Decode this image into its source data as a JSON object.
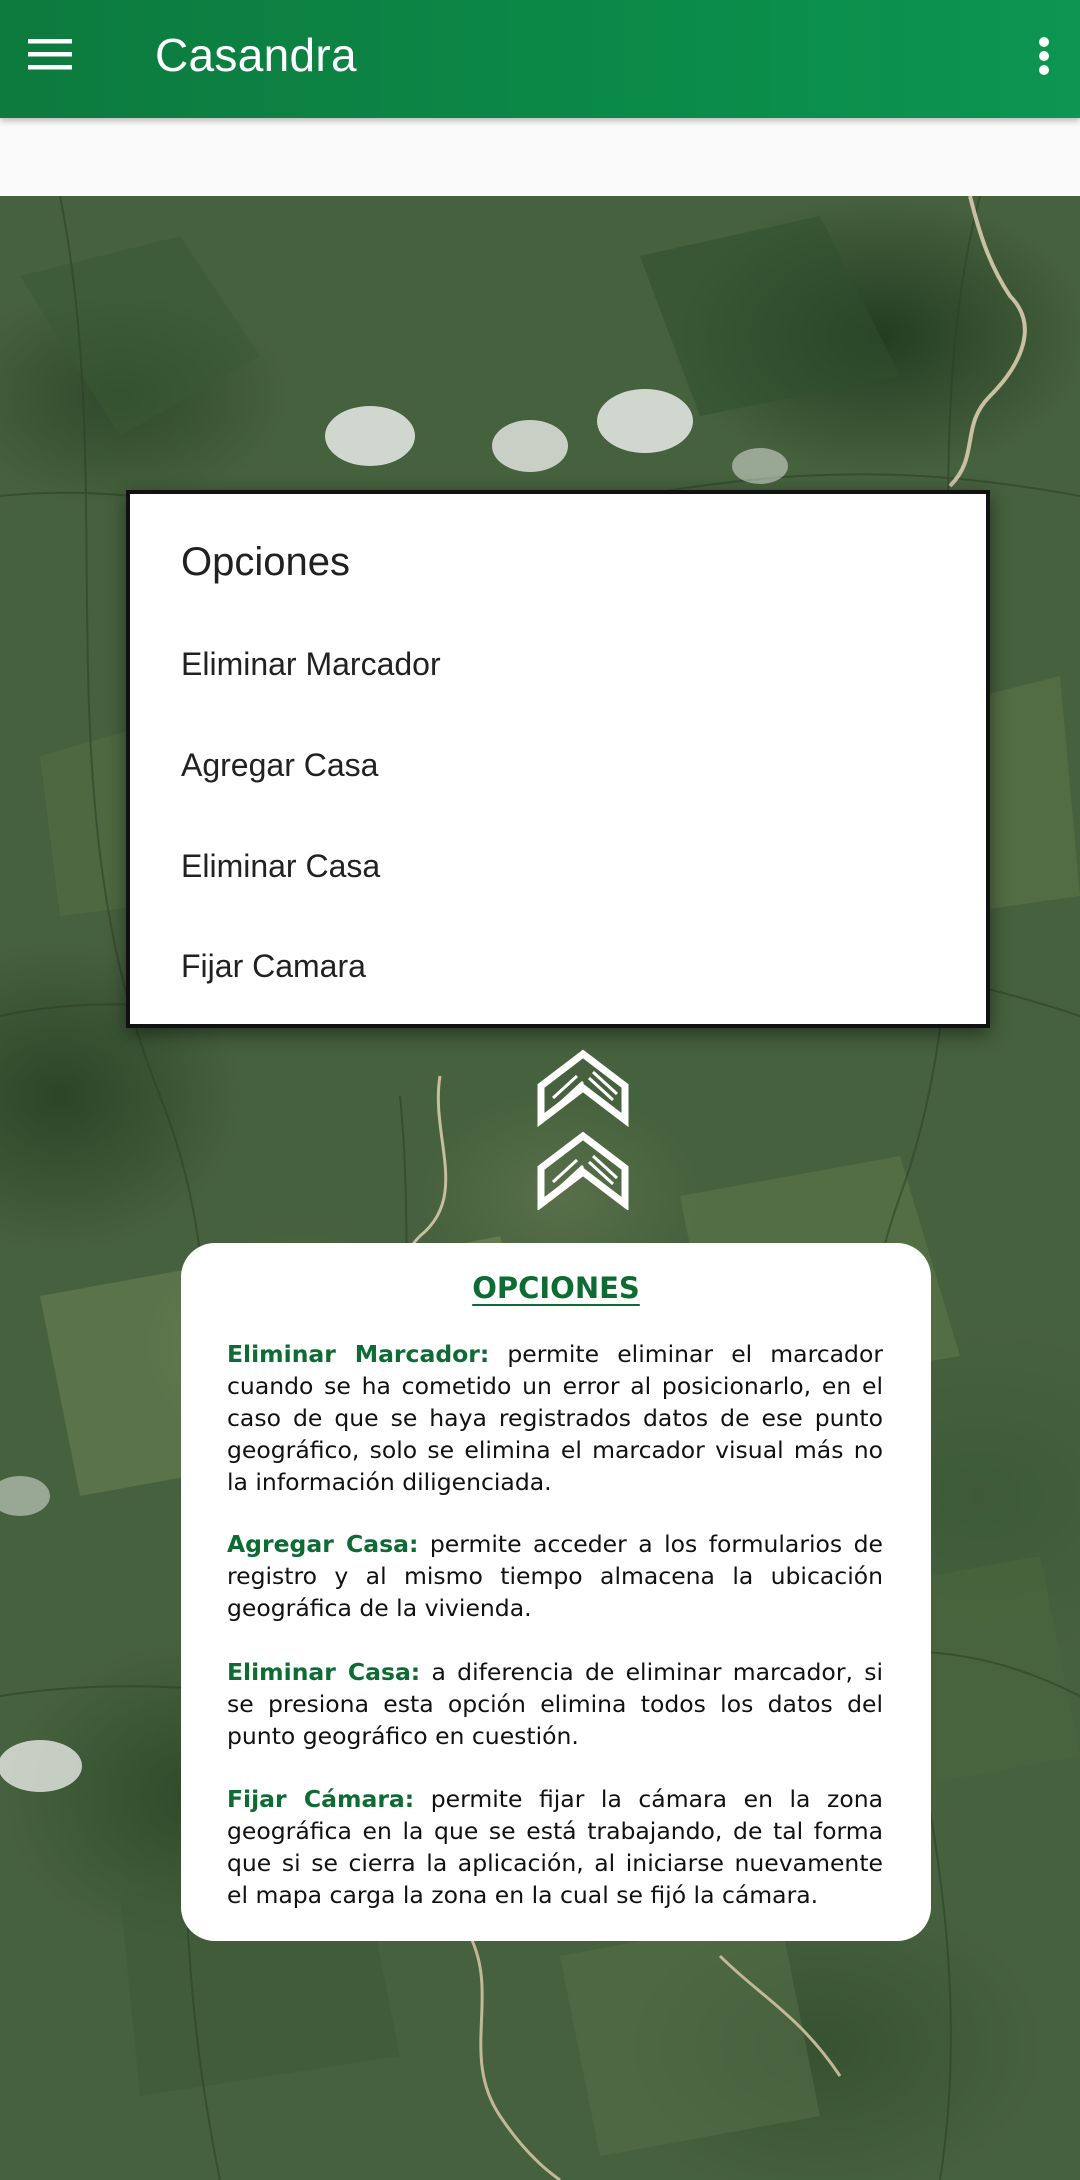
{
  "app_bar": {
    "title": "Casandra",
    "menu_icon": "hamburger-menu-icon",
    "overflow_icon": "more-vert-icon",
    "color": "#0b8a48"
  },
  "dialog": {
    "title": "Opciones",
    "items": [
      {
        "label": "Eliminar Marcador"
      },
      {
        "label": "Agregar Casa"
      },
      {
        "label": "Eliminar Casa"
      },
      {
        "label": "Fijar Camara"
      }
    ]
  },
  "chevron_icon": "double-chevron-up-icon",
  "info_card": {
    "heading": "OPCIONES",
    "accent_color": "#0e6b34",
    "entries": [
      {
        "term": "Eliminar Marcador:",
        "description": "permite eliminar el marcador cuando se ha cometido un error al posicionarlo, en el caso de que se haya registrados datos de ese punto geográfico, solo se elimina el marcador visual más no la información diligenciada."
      },
      {
        "term": "Agregar Casa:",
        "description": "permite acceder a los formularios de registro y al mismo tiempo almacena la ubicación geográfica de la vivienda."
      },
      {
        "term": "Eliminar Casa:",
        "description": "a diferencia de eliminar marcador, si se presiona esta opción elimina todos los datos del punto geográfico en cuestión."
      },
      {
        "term": "Fijar Cámara:",
        "description": "permite fijar la cámara en la zona geográfica en la que se está trabajando, de tal forma que si se cierra la aplicación, al iniciarse nuevamente el mapa carga la zona en la cual se fijó la cámara."
      }
    ]
  }
}
